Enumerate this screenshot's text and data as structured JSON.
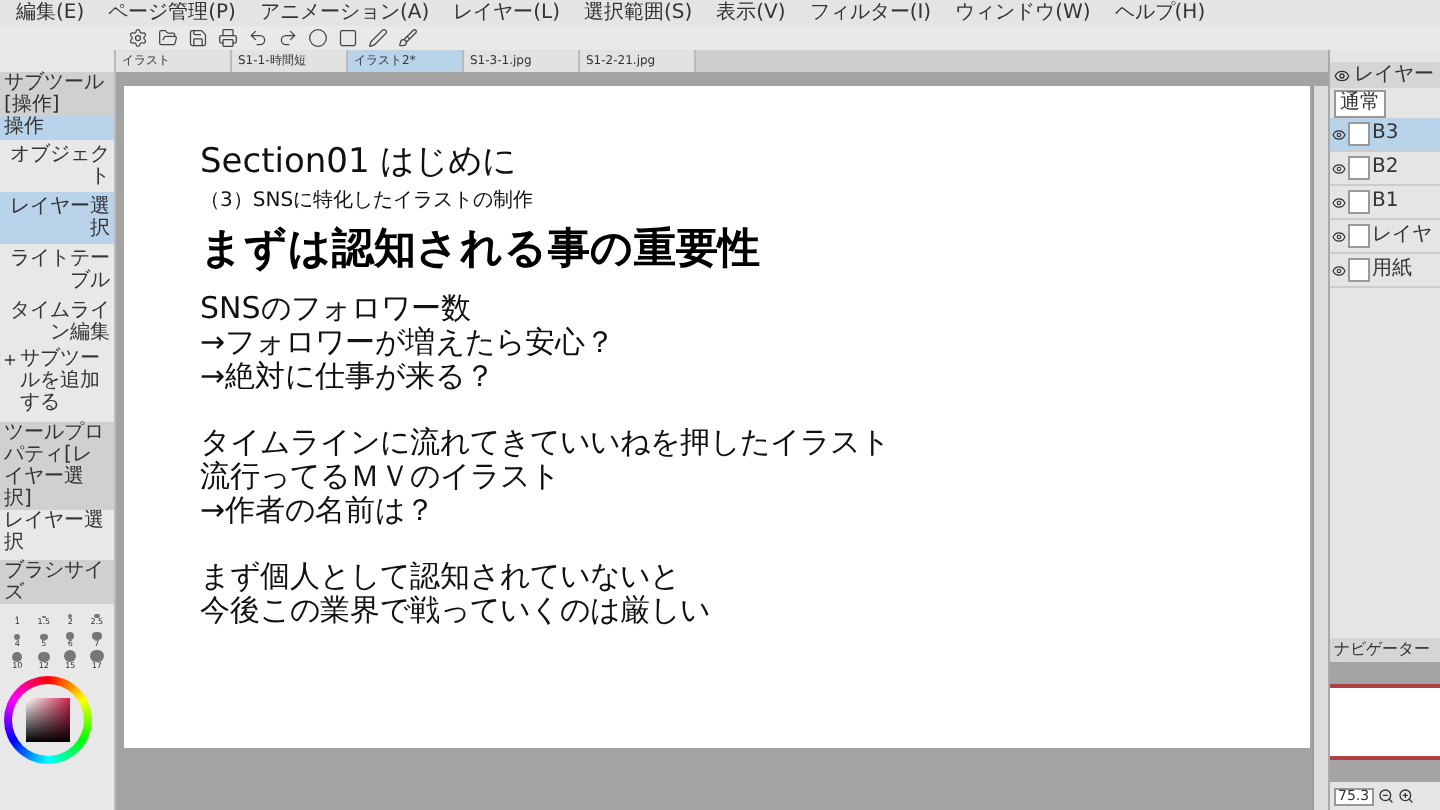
{
  "menu": [
    "編集(E)",
    "ページ管理(P)",
    "アニメーション(A)",
    "レイヤー(L)",
    "選択範囲(S)",
    "表示(V)",
    "フィルター(I)",
    "ウィンドウ(W)",
    "ヘルプ(H)"
  ],
  "tabs": [
    {
      "label": "イラスト",
      "selected": false
    },
    {
      "label": "S1-1-時間短",
      "selected": false
    },
    {
      "label": "イラスト2*",
      "selected": true
    },
    {
      "label": "S1-3-1.jpg",
      "selected": false
    },
    {
      "label": "S1-2-21.jpg",
      "selected": false
    }
  ],
  "subtool": {
    "title": "サブツール[操作]",
    "group": "操作",
    "items": [
      {
        "label": "オブジェクト",
        "selected": false
      },
      {
        "label": "レイヤー選択",
        "selected": true
      },
      {
        "label": "ライトテーブル",
        "selected": false
      },
      {
        "label": "タイムライン編集",
        "selected": false
      }
    ],
    "add_label": "サブツールを追加する"
  },
  "tool_property": {
    "title": "ツールプロパティ[レイヤー選択]",
    "name": "レイヤー選択"
  },
  "brush_size": {
    "title": "ブラシサイズ",
    "sizes": [
      "1",
      "1.5",
      "2",
      "2.5",
      "4",
      "5",
      "6",
      "7",
      "10",
      "12",
      "15",
      "17"
    ]
  },
  "slide": {
    "section": "Section01 はじめに",
    "subtitle": "（3）SNSに特化したイラストの制作",
    "heading": "まずは認知される事の重要性",
    "paragraphs": [
      [
        "SNSのフォロワー数",
        "→フォロワーが増えたら安心？",
        "→絶対に仕事が来る？"
      ],
      [
        "タイムラインに流れてきていいねを押したイラスト",
        "流行ってるＭＶのイラスト",
        "→作者の名前は？"
      ],
      [
        "まず個人として認知されていないと",
        "今後この業界で戦っていくのは厳しい"
      ]
    ]
  },
  "layers_panel": {
    "title": "レイヤー",
    "blend": "通常",
    "layers": [
      {
        "name": "B3",
        "selected": true
      },
      {
        "name": "B2",
        "selected": false
      },
      {
        "name": "B1",
        "selected": false
      },
      {
        "name": "レイヤ",
        "selected": false
      },
      {
        "name": "用紙",
        "selected": false
      }
    ]
  },
  "navigator": {
    "title": "ナビゲーター",
    "zoom": "75.3"
  }
}
